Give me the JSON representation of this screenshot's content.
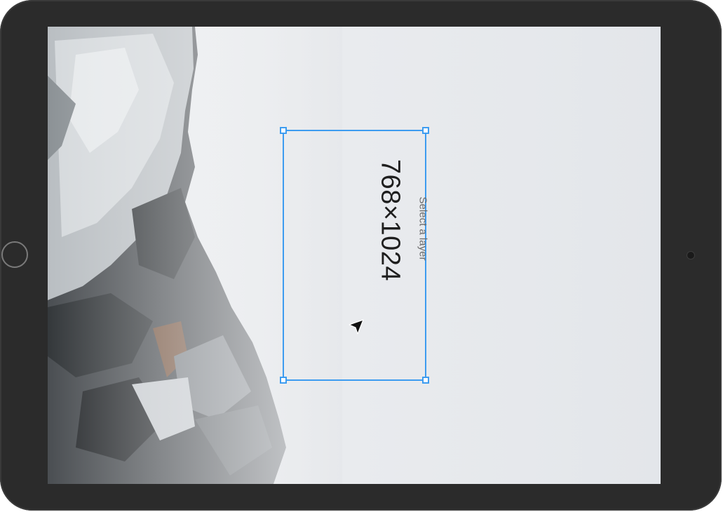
{
  "artboard": {
    "hint_label": "Select a layer",
    "dimensions_label": "768×1024"
  },
  "icons": {
    "cursor": "arrow-cursor-icon",
    "home": "home-button-icon",
    "camera": "camera-icon"
  },
  "colors": {
    "selection": "#3d9cf0",
    "bezel": "#2b2b2b"
  }
}
